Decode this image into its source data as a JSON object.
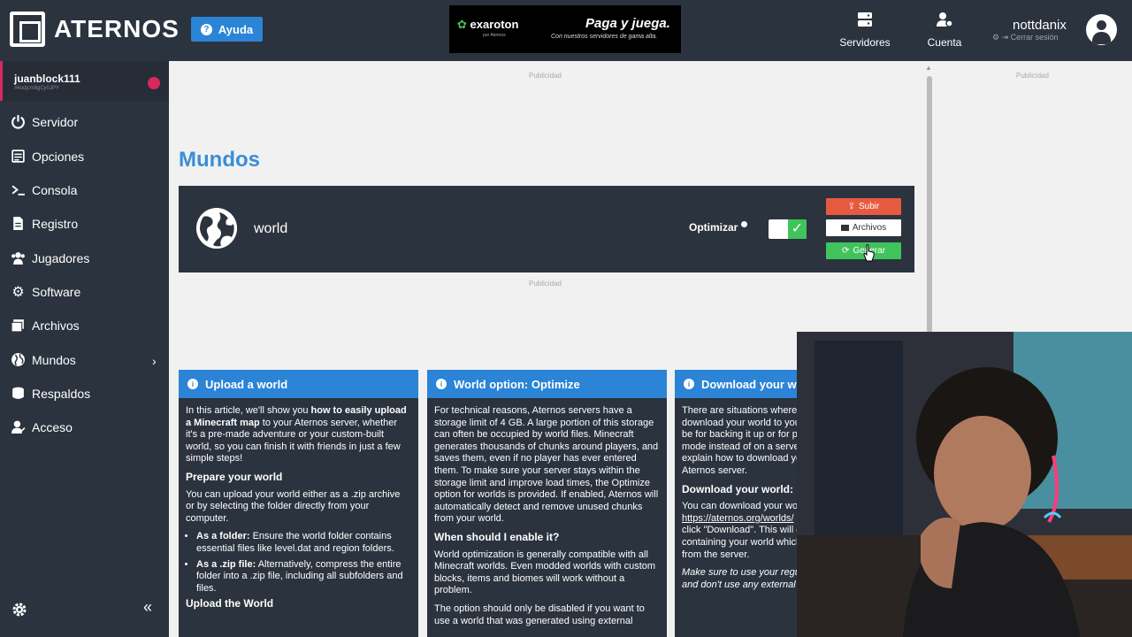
{
  "header": {
    "logo_text": "ATERNOS",
    "help_label": "Ayuda",
    "ad": {
      "brand": "exaroton",
      "brand_sub": "por Aternos",
      "headline": "Paga y juega.",
      "sub": "Con nuestros servidores de gama alta."
    },
    "nav": [
      {
        "label": "Servidores",
        "icon": "servers-icon"
      },
      {
        "label": "Cuenta",
        "icon": "account-icon"
      }
    ],
    "user": {
      "name": "nottdanix",
      "logout": "Cerrar sesión"
    }
  },
  "sidebar": {
    "server": {
      "name": "juanblock111",
      "id": "#4odjcm8gCy0JPY",
      "status_color": "#d9285e"
    },
    "items": [
      {
        "label": "Servidor",
        "icon": "power-icon"
      },
      {
        "label": "Opciones",
        "icon": "options-icon"
      },
      {
        "label": "Consola",
        "icon": "console-icon"
      },
      {
        "label": "Registro",
        "icon": "log-icon"
      },
      {
        "label": "Jugadores",
        "icon": "players-icon"
      },
      {
        "label": "Software",
        "icon": "software-icon"
      },
      {
        "label": "Archivos",
        "icon": "files-icon"
      },
      {
        "label": "Mundos",
        "icon": "globe-icon"
      },
      {
        "label": "Respaldos",
        "icon": "backups-icon"
      },
      {
        "label": "Acceso",
        "icon": "access-icon"
      }
    ]
  },
  "main": {
    "ad_label": "Publicidad",
    "title": "Mundos",
    "world": {
      "name": "world",
      "optimize_label": "Optimizar",
      "optimize_enabled": true,
      "buttons": {
        "upload": "Subir",
        "files": "Archivos",
        "regenerate": "Generar"
      }
    },
    "cards": [
      {
        "title": "Upload a world",
        "intro_pre": "In this article, we'll show you ",
        "intro_bold": "how to easily upload a Minecraft map",
        "intro_post": " to your Aternos server, whether it's a pre-made adventure or your custom-built world, so you can finish it with friends in just a few simple steps!",
        "h1": "Prepare your world",
        "p1": "You can upload your world either as a .zip archive or by selecting the folder directly from your computer.",
        "li1_bold": "As a folder:",
        "li1": " Ensure the world folder contains essential files like level.dat and region folders.",
        "li2_bold": "As a .zip file:",
        "li2": " Alternatively, compress the entire folder into a .zip file, including all subfolders and files.",
        "h2": "Upload the World"
      },
      {
        "title": "World option: Optimize",
        "p1": "For technical reasons, Aternos servers have a storage limit of 4 GB. A large portion of this storage can often be occupied by world files. Minecraft generates thousands of chunks around players, and saves them, even if no player has ever entered them. To make sure your server stays within the storage limit and improve load times, the Optimize option for worlds is provided. If enabled, Aternos will automatically detect and remove unused chunks from your world.",
        "h1": "When should I enable it?",
        "p2": "World optimization is generally compatible with all Minecraft worlds. Even modded worlds with custom blocks, items and biomes will work without a problem.",
        "p3": "The option should only be disabled if you want to use a world that was generated using external"
      },
      {
        "title": "Download your world",
        "p1": "There are situations where you might want to download your world to your computer. This could be for backing it up or for playing it in single player mode instead of on a server. In this article we will explain how to download your world from your Aternos server.",
        "h1": "Download your world:",
        "p2_pre": "You can download your world from the Worlds page: ",
        "link": "https://aternos.org/worlds/",
        "p2_post": " Select your world and click \"Download\". This will download a .zip containing your world which can be downloaded from the server.",
        "p3": "Make sure to use your regular browser to download and don't use any external download managers."
      }
    ]
  }
}
